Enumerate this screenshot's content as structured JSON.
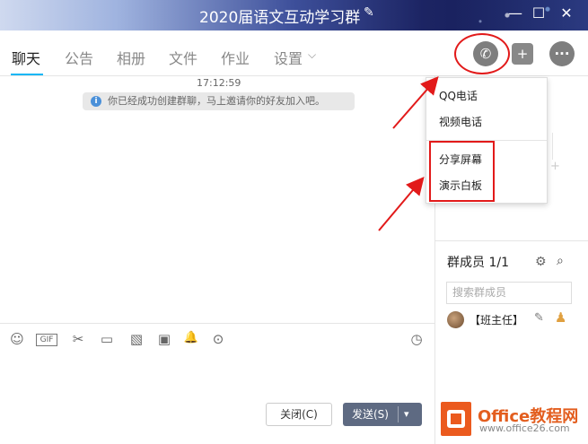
{
  "window": {
    "title": "2020届语文互动学习群",
    "edit_icon": "pencil-icon",
    "min_icon": "minimize-icon",
    "max_icon": "maximize-icon",
    "close_icon": "close-icon",
    "min_glyph": "—",
    "max_glyph": "☐",
    "close_glyph": "✕"
  },
  "tabs": [
    {
      "label": "聊天",
      "active": true
    },
    {
      "label": "公告"
    },
    {
      "label": "相册"
    },
    {
      "label": "文件"
    },
    {
      "label": "作业"
    },
    {
      "label": "设置"
    }
  ],
  "tab_dropdown_glyph": "⌵",
  "top_actions": {
    "phone_icon": "phone-icon",
    "add_msg_icon": "add-message-icon",
    "more_icon": "more-icon"
  },
  "chat": {
    "time": "17:12:59",
    "system_message": "你已经成功创建群聊，马上邀请你的好友加入吧。",
    "info_glyph": "i"
  },
  "call_menu": {
    "items": [
      "QQ电话",
      "视频电话",
      "分享屏幕",
      "演示白板"
    ]
  },
  "toolbar_icons": [
    "emoji-icon",
    "gif-icon",
    "scissors-icon",
    "folder-icon",
    "image-edit-icon",
    "picture-icon",
    "bell-icon",
    "more-circle-icon",
    "history-clock-icon"
  ],
  "toolbar_glyphs": [
    "☺",
    "GIF",
    "✂",
    "▭",
    "▧",
    "▣",
    "🔔",
    "⊙",
    "◷"
  ],
  "buttons": {
    "close_label": "关闭(C)",
    "send_label": "发送(S)",
    "send_caret": "▾"
  },
  "members": {
    "title": "群成员 1/1",
    "search_placeholder": "搜索群成员",
    "member_name": "【班主任】"
  },
  "watermark": {
    "name": "Office教程网",
    "url": "www.office26.com"
  },
  "colors": {
    "annotation_red": "#e21a1a",
    "accent_blue": "#12b7f5",
    "send_button": "#5e6a82"
  }
}
